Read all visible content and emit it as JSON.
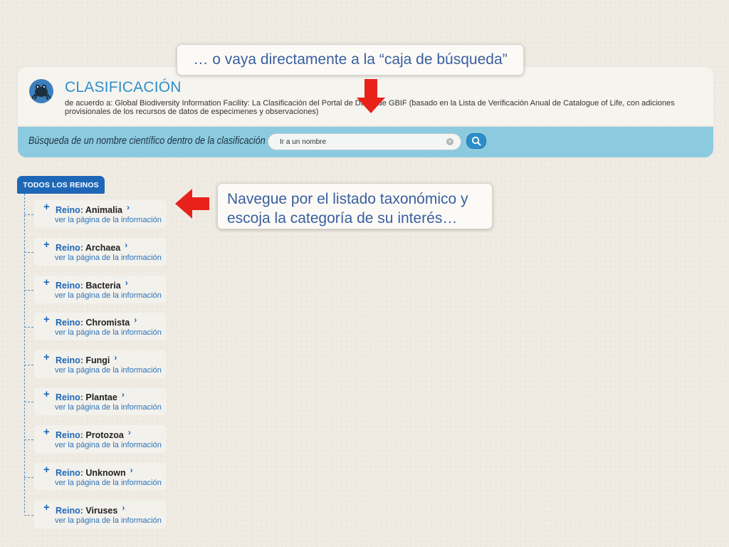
{
  "callouts": {
    "search_hint": "… o vaya directamente a la “caja de búsqueda”",
    "browse_hint_line1": "Navegue por el listado taxonómico y",
    "browse_hint_line2": "escoja la categoría de su interés…"
  },
  "header": {
    "title": "CLASIFICACIÓN",
    "subtitle": "de acuerdo a: Global Biodiversity Information Facility: La Clasificación del Portal de Datos de GBIF (basado en la Lista de Verificación Anual de Catalogue of Life, con adiciones provisionales de los recursos de datos de especimenes y observaciones)",
    "logo_icon": "frog-icon"
  },
  "search": {
    "label": "Búsqueda de un nombre científico dentro de la clasificación",
    "placeholder": "Ir a un nombre",
    "value": "",
    "clear_icon": "clear-icon",
    "button_icon": "search-icon"
  },
  "tree": {
    "all_kingdoms_label": "TODOS LOS REINOS",
    "rank_label": "Reino:",
    "info_link_label": "ver la página de la información",
    "expand_glyph": "+",
    "chevron_glyph": "›",
    "items": [
      {
        "name": "Animalia"
      },
      {
        "name": "Archaea"
      },
      {
        "name": "Bacteria"
      },
      {
        "name": "Chromista"
      },
      {
        "name": "Fungi"
      },
      {
        "name": "Plantae"
      },
      {
        "name": "Protozoa"
      },
      {
        "name": "Unknown"
      },
      {
        "name": "Viruses"
      }
    ]
  },
  "colors": {
    "accent_blue": "#1e67b6",
    "title_blue": "#2d8fcc",
    "search_bar": "#8ccbdf",
    "highlight_red": "#e8221b",
    "background": "#efebe2"
  }
}
